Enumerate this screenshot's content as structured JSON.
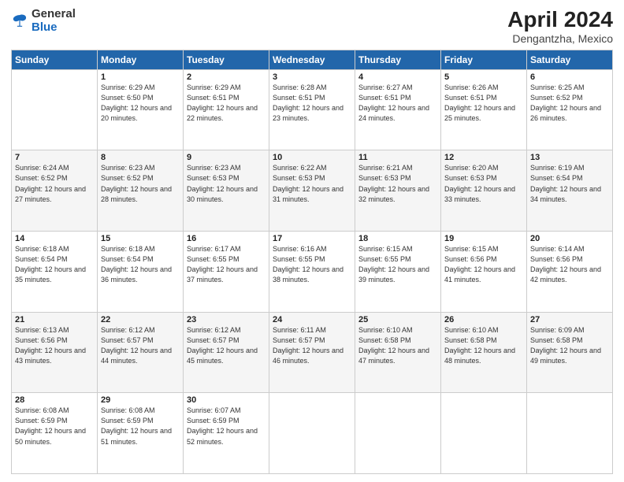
{
  "logo": {
    "general": "General",
    "blue": "Blue"
  },
  "header": {
    "title": "April 2024",
    "subtitle": "Dengantzha, Mexico"
  },
  "weekdays": [
    "Sunday",
    "Monday",
    "Tuesday",
    "Wednesday",
    "Thursday",
    "Friday",
    "Saturday"
  ],
  "weeks": [
    [
      {
        "day": "",
        "sunrise": "",
        "sunset": "",
        "daylight": ""
      },
      {
        "day": "1",
        "sunrise": "Sunrise: 6:29 AM",
        "sunset": "Sunset: 6:50 PM",
        "daylight": "Daylight: 12 hours and 20 minutes."
      },
      {
        "day": "2",
        "sunrise": "Sunrise: 6:29 AM",
        "sunset": "Sunset: 6:51 PM",
        "daylight": "Daylight: 12 hours and 22 minutes."
      },
      {
        "day": "3",
        "sunrise": "Sunrise: 6:28 AM",
        "sunset": "Sunset: 6:51 PM",
        "daylight": "Daylight: 12 hours and 23 minutes."
      },
      {
        "day": "4",
        "sunrise": "Sunrise: 6:27 AM",
        "sunset": "Sunset: 6:51 PM",
        "daylight": "Daylight: 12 hours and 24 minutes."
      },
      {
        "day": "5",
        "sunrise": "Sunrise: 6:26 AM",
        "sunset": "Sunset: 6:51 PM",
        "daylight": "Daylight: 12 hours and 25 minutes."
      },
      {
        "day": "6",
        "sunrise": "Sunrise: 6:25 AM",
        "sunset": "Sunset: 6:52 PM",
        "daylight": "Daylight: 12 hours and 26 minutes."
      }
    ],
    [
      {
        "day": "7",
        "sunrise": "Sunrise: 6:24 AM",
        "sunset": "Sunset: 6:52 PM",
        "daylight": "Daylight: 12 hours and 27 minutes."
      },
      {
        "day": "8",
        "sunrise": "Sunrise: 6:23 AM",
        "sunset": "Sunset: 6:52 PM",
        "daylight": "Daylight: 12 hours and 28 minutes."
      },
      {
        "day": "9",
        "sunrise": "Sunrise: 6:23 AM",
        "sunset": "Sunset: 6:53 PM",
        "daylight": "Daylight: 12 hours and 30 minutes."
      },
      {
        "day": "10",
        "sunrise": "Sunrise: 6:22 AM",
        "sunset": "Sunset: 6:53 PM",
        "daylight": "Daylight: 12 hours and 31 minutes."
      },
      {
        "day": "11",
        "sunrise": "Sunrise: 6:21 AM",
        "sunset": "Sunset: 6:53 PM",
        "daylight": "Daylight: 12 hours and 32 minutes."
      },
      {
        "day": "12",
        "sunrise": "Sunrise: 6:20 AM",
        "sunset": "Sunset: 6:53 PM",
        "daylight": "Daylight: 12 hours and 33 minutes."
      },
      {
        "day": "13",
        "sunrise": "Sunrise: 6:19 AM",
        "sunset": "Sunset: 6:54 PM",
        "daylight": "Daylight: 12 hours and 34 minutes."
      }
    ],
    [
      {
        "day": "14",
        "sunrise": "Sunrise: 6:18 AM",
        "sunset": "Sunset: 6:54 PM",
        "daylight": "Daylight: 12 hours and 35 minutes."
      },
      {
        "day": "15",
        "sunrise": "Sunrise: 6:18 AM",
        "sunset": "Sunset: 6:54 PM",
        "daylight": "Daylight: 12 hours and 36 minutes."
      },
      {
        "day": "16",
        "sunrise": "Sunrise: 6:17 AM",
        "sunset": "Sunset: 6:55 PM",
        "daylight": "Daylight: 12 hours and 37 minutes."
      },
      {
        "day": "17",
        "sunrise": "Sunrise: 6:16 AM",
        "sunset": "Sunset: 6:55 PM",
        "daylight": "Daylight: 12 hours and 38 minutes."
      },
      {
        "day": "18",
        "sunrise": "Sunrise: 6:15 AM",
        "sunset": "Sunset: 6:55 PM",
        "daylight": "Daylight: 12 hours and 39 minutes."
      },
      {
        "day": "19",
        "sunrise": "Sunrise: 6:15 AM",
        "sunset": "Sunset: 6:56 PM",
        "daylight": "Daylight: 12 hours and 41 minutes."
      },
      {
        "day": "20",
        "sunrise": "Sunrise: 6:14 AM",
        "sunset": "Sunset: 6:56 PM",
        "daylight": "Daylight: 12 hours and 42 minutes."
      }
    ],
    [
      {
        "day": "21",
        "sunrise": "Sunrise: 6:13 AM",
        "sunset": "Sunset: 6:56 PM",
        "daylight": "Daylight: 12 hours and 43 minutes."
      },
      {
        "day": "22",
        "sunrise": "Sunrise: 6:12 AM",
        "sunset": "Sunset: 6:57 PM",
        "daylight": "Daylight: 12 hours and 44 minutes."
      },
      {
        "day": "23",
        "sunrise": "Sunrise: 6:12 AM",
        "sunset": "Sunset: 6:57 PM",
        "daylight": "Daylight: 12 hours and 45 minutes."
      },
      {
        "day": "24",
        "sunrise": "Sunrise: 6:11 AM",
        "sunset": "Sunset: 6:57 PM",
        "daylight": "Daylight: 12 hours and 46 minutes."
      },
      {
        "day": "25",
        "sunrise": "Sunrise: 6:10 AM",
        "sunset": "Sunset: 6:58 PM",
        "daylight": "Daylight: 12 hours and 47 minutes."
      },
      {
        "day": "26",
        "sunrise": "Sunrise: 6:10 AM",
        "sunset": "Sunset: 6:58 PM",
        "daylight": "Daylight: 12 hours and 48 minutes."
      },
      {
        "day": "27",
        "sunrise": "Sunrise: 6:09 AM",
        "sunset": "Sunset: 6:58 PM",
        "daylight": "Daylight: 12 hours and 49 minutes."
      }
    ],
    [
      {
        "day": "28",
        "sunrise": "Sunrise: 6:08 AM",
        "sunset": "Sunset: 6:59 PM",
        "daylight": "Daylight: 12 hours and 50 minutes."
      },
      {
        "day": "29",
        "sunrise": "Sunrise: 6:08 AM",
        "sunset": "Sunset: 6:59 PM",
        "daylight": "Daylight: 12 hours and 51 minutes."
      },
      {
        "day": "30",
        "sunrise": "Sunrise: 6:07 AM",
        "sunset": "Sunset: 6:59 PM",
        "daylight": "Daylight: 12 hours and 52 minutes."
      },
      {
        "day": "",
        "sunrise": "",
        "sunset": "",
        "daylight": ""
      },
      {
        "day": "",
        "sunrise": "",
        "sunset": "",
        "daylight": ""
      },
      {
        "day": "",
        "sunrise": "",
        "sunset": "",
        "daylight": ""
      },
      {
        "day": "",
        "sunrise": "",
        "sunset": "",
        "daylight": ""
      }
    ]
  ]
}
